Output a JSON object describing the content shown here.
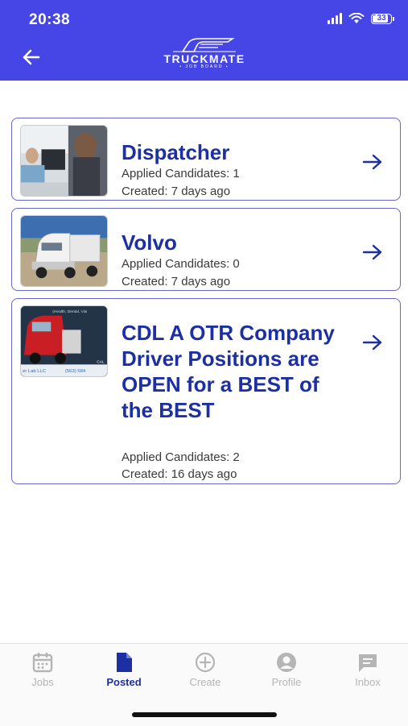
{
  "status_bar": {
    "time": "20:38",
    "battery": "33"
  },
  "header": {
    "logo_name": "TRUCKMATE",
    "logo_sub": "• JOB BOARD •"
  },
  "jobs": [
    {
      "title": "Dispatcher",
      "applied": "Applied Candidates: 1",
      "created": "Created: 7 days ago",
      "image": "office-headset-photo"
    },
    {
      "title": "Volvo",
      "applied": "Applied Candidates: 0",
      "created": "Created: 7 days ago",
      "image": "white-semi-truck-photo"
    },
    {
      "title": "CDL A OTR Company Driver Positions are OPEN for a BEST of the BEST",
      "applied": "Applied Candidates: 2",
      "created": "Created: 16 days ago",
      "image": "red-truck-banner-photo",
      "thumb_text": {
        "top": "(Health, Dental, Visi",
        "bottom_left": "er Lab LLC",
        "phone": "(563) 584",
        "cal": "CAL"
      }
    }
  ],
  "tabs": [
    {
      "label": "Jobs",
      "icon": "calendar-icon"
    },
    {
      "label": "Posted",
      "icon": "document-icon",
      "active": true
    },
    {
      "label": "Create",
      "icon": "plus-circle-icon"
    },
    {
      "label": "Profile",
      "icon": "user-circle-icon"
    },
    {
      "label": "Inbox",
      "icon": "message-icon"
    }
  ],
  "colors": {
    "header": "#4646e6",
    "accent": "#1c2fa3",
    "card_border": "#6466c9"
  }
}
